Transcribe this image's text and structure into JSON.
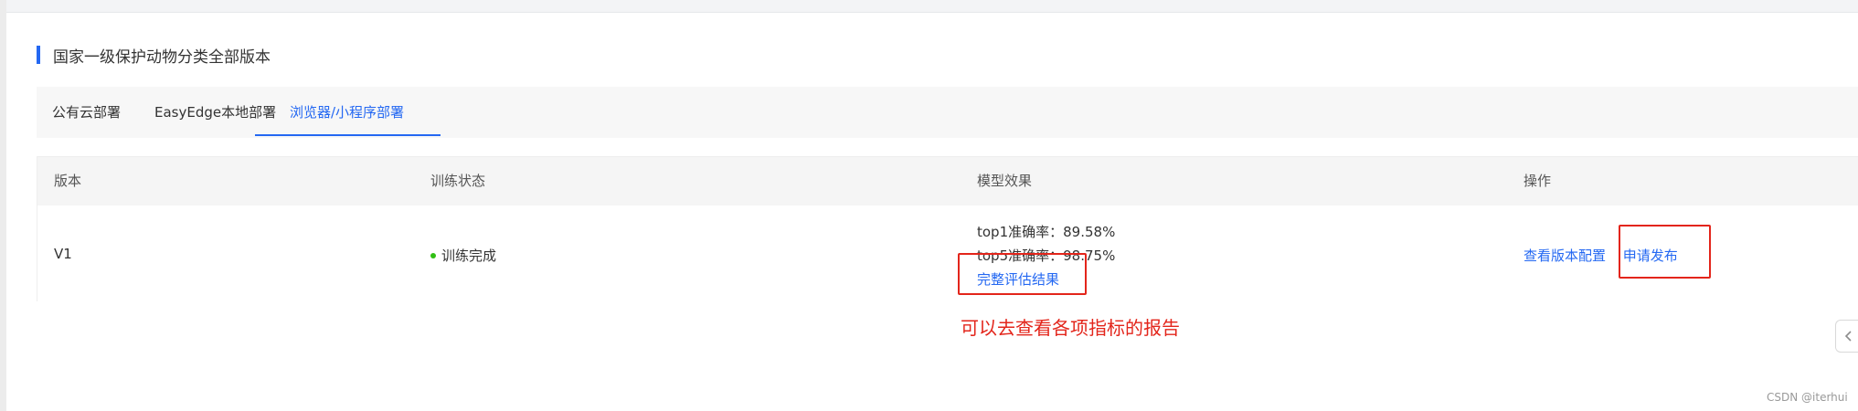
{
  "section": {
    "title": "国家一级保护动物分类全部版本"
  },
  "tabs": [
    {
      "label": "公有云部署"
    },
    {
      "label": "EasyEdge本地部署"
    },
    {
      "label": "浏览器/小程序部署"
    }
  ],
  "active_tab": "浏览器/小程序部署",
  "table": {
    "headers": [
      "版本",
      "训练状态",
      "模型效果",
      "操作"
    ],
    "rows": [
      {
        "version": "V1",
        "status": "训练完成",
        "top1": "top1准确率：89.58%",
        "top5": "top5准确率：98.75%",
        "eval_link": "完整评估结果",
        "action_view": "查看版本配置",
        "action_publish": "申请发布"
      }
    ]
  },
  "annotation": "可以去查看各项指标的报告",
  "watermark": "CSDN @iterhui",
  "colors": {
    "accent": "#2468f2",
    "success": "#30bf13",
    "highlight": "#e3251b"
  },
  "icons": {
    "collapse": "chevron-left-icon"
  }
}
